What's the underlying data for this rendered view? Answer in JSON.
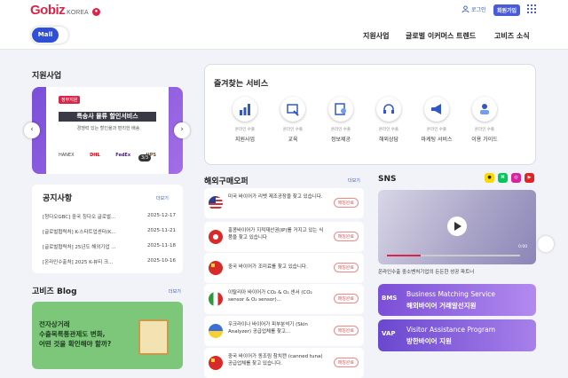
{
  "header": {
    "logo": "Gobiz",
    "logo_sub": "KOREA",
    "login": "로그인",
    "join": "회원가입"
  },
  "nav": {
    "mall": "Mall",
    "menu": [
      "지원사업",
      "글로벌 이커머스 트렌드",
      "고비즈 소식"
    ]
  },
  "support": {
    "title": "지원사업",
    "banner_tag": "정부지원",
    "banner_title": "특송사 물류 할인서비스",
    "banner_sub": "경쟁력 있는 할인율과 편리한 배송",
    "banner_logos": [
      "HANEX",
      "DHL",
      "FedEx",
      "UPS"
    ],
    "page": "3/3"
  },
  "notice": {
    "title": "공지사항",
    "more": "더보기",
    "items": [
      {
        "text": "[청다오GBC] 중국 칭다오 글로벌...",
        "date": "2025-12-17"
      },
      {
        "text": "[글로벌협력처] K-스타트업센터(K...",
        "date": "2025-11-21"
      },
      {
        "text": "[글로벌협력처] 25년도 해외기업 ...",
        "date": "2025-11-18"
      },
      {
        "text": "[온라인수출처] 2025 K-뷰티 크...",
        "date": "2025-10-16"
      }
    ]
  },
  "blog": {
    "title": "고비즈 Blog",
    "more": "더보기",
    "text": "전자상거래\n수출목록통관제도 변화,\n어떤 것을 확인해야 할까?"
  },
  "favorites": {
    "title": "즐겨찾는 서비스",
    "items": [
      {
        "small": "온라인 수출",
        "label": "지원사업",
        "icon": "chart-icon"
      },
      {
        "small": "온라인 수출",
        "label": "교육",
        "icon": "education-icon"
      },
      {
        "small": "온라인 수출",
        "label": "정보제공",
        "icon": "info-icon"
      },
      {
        "small": "온라인 수출",
        "label": "해외상담",
        "icon": "headset-icon"
      },
      {
        "small": "온라인 수출",
        "label": "마케팅 서비스",
        "icon": "megaphone-icon"
      },
      {
        "small": "온라인 수출",
        "label": "이용 가이드",
        "icon": "guide-icon"
      }
    ]
  },
  "buyers": {
    "title": "해외구매오퍼",
    "more": "더보기",
    "badge": "매칭완료",
    "items": [
      {
        "text": "미국 바이어가 리벳 제조공장을 찾고 있습니다.",
        "country": "US"
      },
      {
        "text": "홍콩바이어가 지적재산권(IP)를 거지고 있는 식품을 찾고 있습니다",
        "country": "HK"
      },
      {
        "text": "중국 바이어가 조미료를 찾고 있습니다.",
        "country": "CN"
      },
      {
        "text": "이탈리아 바이어가 CO₂ & O₂ 센서 (CO₂ sensor & O₂ sensor)...",
        "country": "IT"
      },
      {
        "text": "우크라이나 바이어가 피부분석기 (Skin Analyzer) 공급업체를 찾고...",
        "country": "UA"
      },
      {
        "text": "중국 바이어가 동조림 참치캔 (canned tuna) 공급업체를 찾고 있습니다.",
        "country": "CN"
      }
    ]
  },
  "sns": {
    "title": "SNS",
    "video_caption": "온라인수출 중소벤처기업의 든든한 성공 파트너",
    "time": "0:00",
    "banners": [
      {
        "abbr": "BMS",
        "en": "Business Matching Service",
        "ko": "해외바이어 거래알선지원",
        "color": "#8a5be0"
      },
      {
        "abbr": "VAP",
        "en": "Visitor Assistance Program",
        "ko": "방한바이어 지원",
        "color": "#7b55d6"
      }
    ]
  }
}
